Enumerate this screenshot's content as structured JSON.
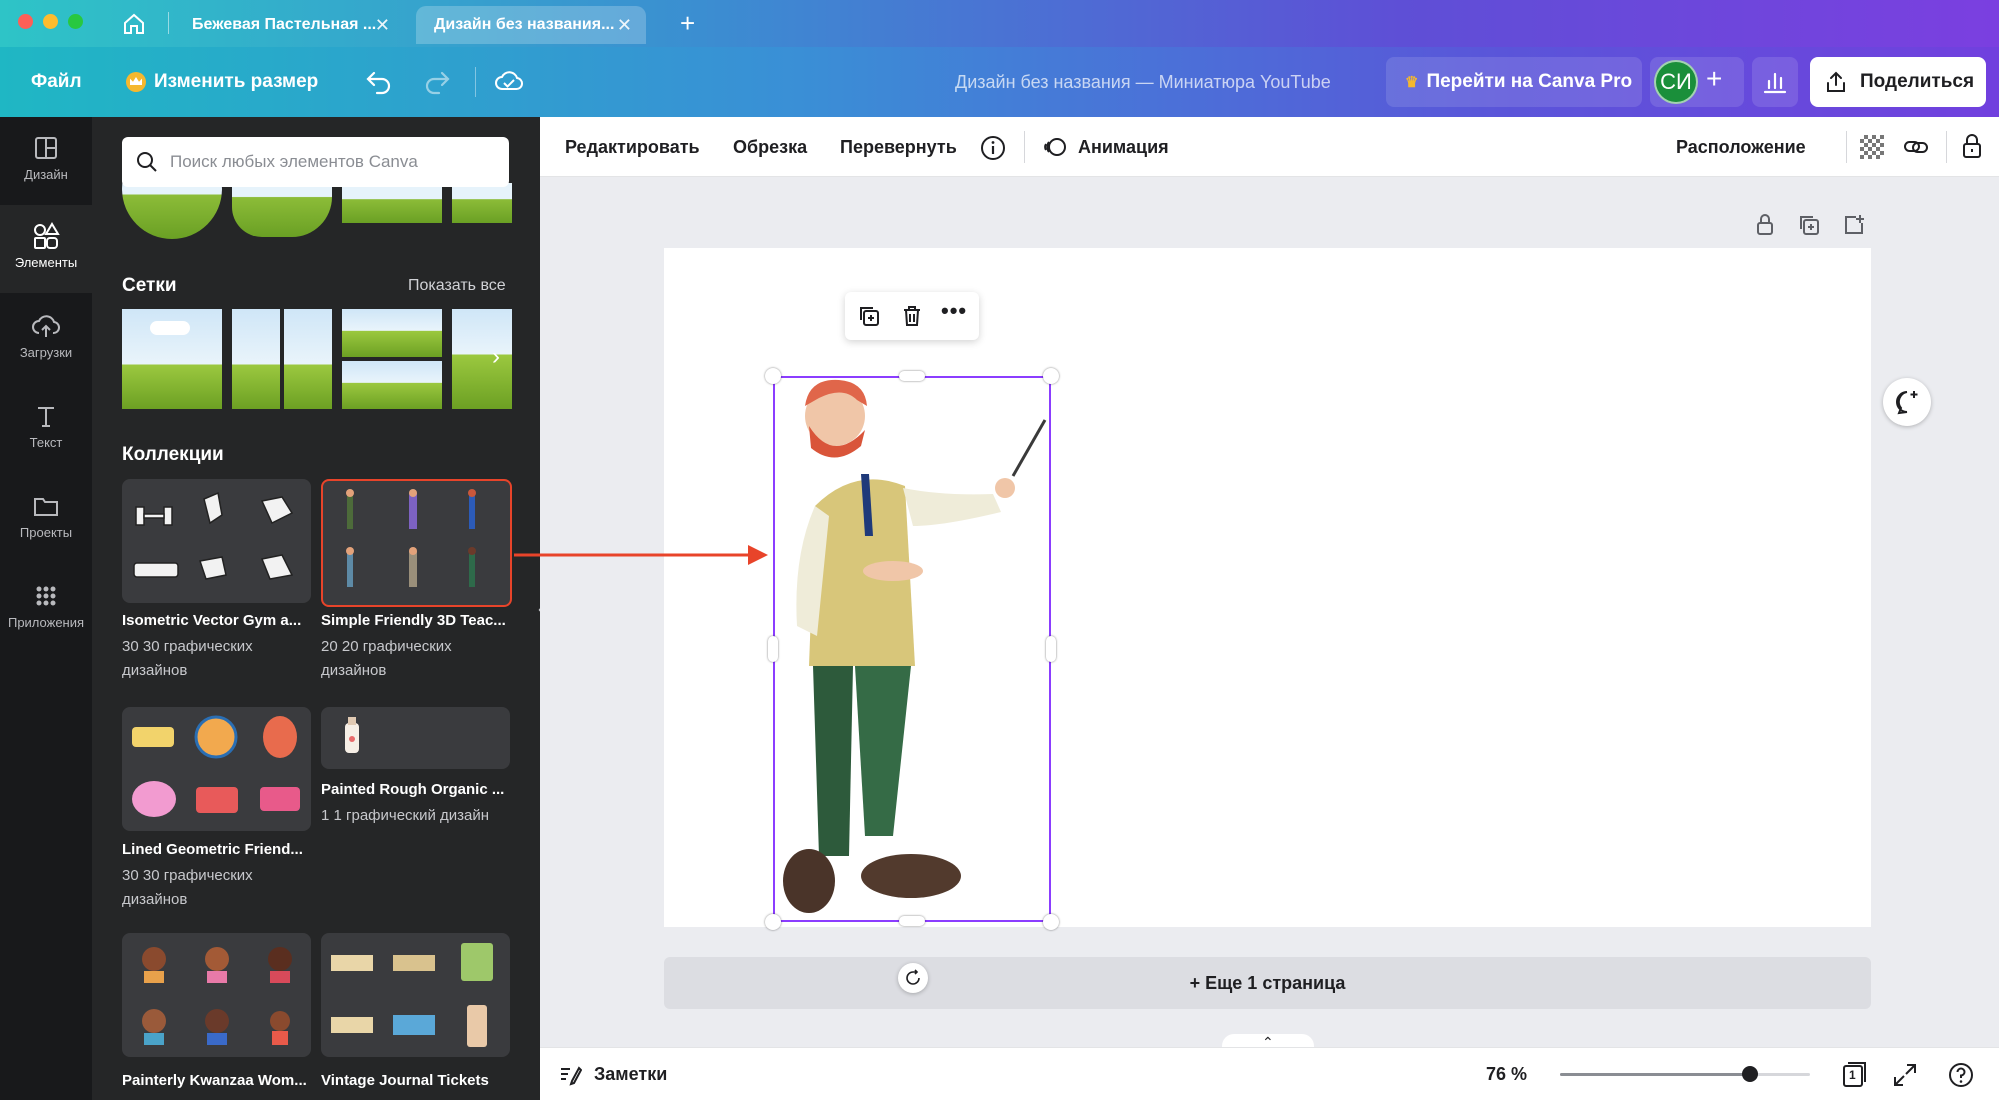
{
  "tabs": [
    {
      "label": "Бежевая Пастельная ..."
    },
    {
      "label": "Дизайн без названия..."
    }
  ],
  "toolbar": {
    "file": "Файл",
    "resize": "Изменить размер",
    "design_title": "Дизайн без названия — Миниатюра YouTube",
    "pro": "Перейти на Canva Pro",
    "avatar": "СИ",
    "share": "Поделиться"
  },
  "rail": [
    {
      "label": "Дизайн",
      "icon": "layout-icon"
    },
    {
      "label": "Элементы",
      "icon": "shapes-icon"
    },
    {
      "label": "Загрузки",
      "icon": "cloud-upload-icon"
    },
    {
      "label": "Текст",
      "icon": "text-icon"
    },
    {
      "label": "Проекты",
      "icon": "folder-icon"
    },
    {
      "label": "Приложения",
      "icon": "apps-grid-icon"
    }
  ],
  "search": {
    "placeholder": "Поиск любых элементов Canva"
  },
  "grids": {
    "title": "Сетки",
    "show_all": "Показать все"
  },
  "collections": {
    "title": "Коллекции",
    "items": [
      {
        "title": "Isometric Vector Gym a...",
        "sub": "30 30 графических дизайнов"
      },
      {
        "title": "Simple Friendly 3D Teac...",
        "sub": "20 20 графических дизайнов"
      },
      {
        "title": "Lined Geometric Friend...",
        "sub": "30 30 графических дизайнов"
      },
      {
        "title": "Painted Rough Organic ...",
        "sub": "1 1 графический дизайн"
      },
      {
        "title": "Painterly Kwanzaa Wom...",
        "sub": ""
      },
      {
        "title": "Vintage Journal Tickets",
        "sub": ""
      }
    ]
  },
  "context": {
    "edit": "Редактировать",
    "crop": "Обрезка",
    "flip": "Перевернуть",
    "animate": "Анимация",
    "position": "Расположение"
  },
  "canvas": {
    "add_page": "+ Еще 1 страница"
  },
  "status": {
    "notes": "Заметки",
    "zoom": "76 %",
    "page_num": "1",
    "zoom_level": 0.76
  },
  "colors": {
    "accent": "#8b3dff",
    "highlight": "#e8442a",
    "crown": "#f5b82e",
    "avatar_bg": "#1a8f3a"
  }
}
